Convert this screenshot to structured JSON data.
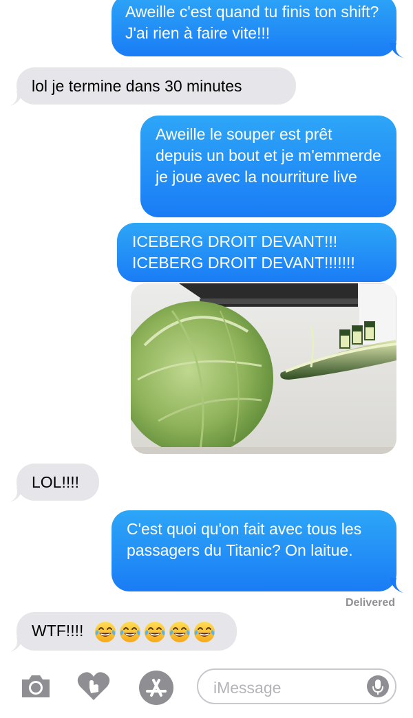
{
  "messages": [
    {
      "dir": "out",
      "text": "Aweille c'est quand tu finis ton shift? J'ai rien à faire vite!!!"
    },
    {
      "dir": "in",
      "text": "lol je termine dans 30 minutes"
    },
    {
      "dir": "out",
      "text": "Aweille le souper est prêt depuis un bout et je m'emmerde je joue avec la nourriture live"
    },
    {
      "dir": "out",
      "text": "ICEBERG DROIT DEVANT!!! ICEBERG DROIT DEVANT!!!!!!!"
    },
    {
      "dir": "out",
      "type": "photo",
      "icon": "lettuce-iceberg-and-cucumber-titanic-photo"
    },
    {
      "dir": "in",
      "text": "LOL!!!!"
    },
    {
      "dir": "out",
      "text": "C'est quoi qu'on fait avec tous les passagers du Titanic? On laitue."
    },
    {
      "dir": "in",
      "text": "WTF!!!!",
      "emoji": [
        "😂",
        "😂",
        "😂",
        "😂",
        "😂"
      ]
    }
  ],
  "status": {
    "delivered": "Delivered"
  },
  "input_bar": {
    "placeholder": "iMessage",
    "icons": [
      "camera-icon",
      "digital-touch-heart-icon",
      "app-store-icon",
      "microphone-icon"
    ]
  },
  "colors": {
    "outgoing_top": "#2da6f7",
    "outgoing_bottom": "#1a7cf5",
    "incoming": "#e6e6ea",
    "delivered": "#8e8e93"
  }
}
